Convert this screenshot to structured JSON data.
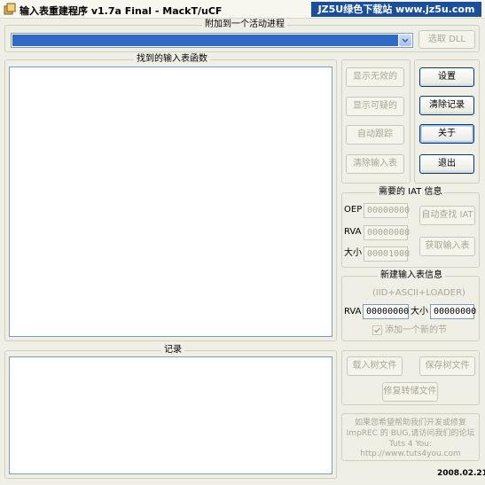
{
  "title_bar": {
    "title": "输入表重建程序 v1.7a Final - MackT/uCF",
    "watermark": "JZ5U绿色下载站 www.jz5u.com"
  },
  "process": {
    "group_label": "附加到一个活动进程",
    "pick_dll_label": "选取 DLL"
  },
  "imports": {
    "group_label": "找到的输入表函数"
  },
  "mid_buttons": {
    "show_invalid": "显示无效的",
    "show_suspect": "显示可疑的",
    "auto_trace": "自动跟踪",
    "clear_imports": "清除输入表"
  },
  "right_buttons": {
    "options": "设置",
    "clear_log": "清除记录",
    "about": "关于",
    "exit": "退出"
  },
  "iat": {
    "group_label": "需要的 IAT 信息",
    "oep_label": "OEP",
    "oep_value": "00000000",
    "rva_label": "RVA",
    "rva_value": "00000000",
    "size_label": "大小",
    "size_value": "00001000",
    "autosearch": "自动查找 IAT",
    "get_imports": "获取输入表"
  },
  "new_import": {
    "group_label": "新建输入表信息",
    "subtitle": "(IID+ASCII+LOADER)",
    "rva_label": "RVA",
    "rva_value": "00000000",
    "size_label": "大小",
    "size_value": "00000000",
    "add_section_label": "添加一个新的节",
    "add_section_checked": true
  },
  "log": {
    "group_label": "记录"
  },
  "tree_buttons": {
    "load_tree": "载入树文件",
    "save_tree": "保存树文件",
    "fix_dump": "修复转储文件"
  },
  "footer": {
    "line1": "如果您希望帮助我们开发或修复",
    "line2": "ImpREC 的 BUG,请访问我们的论坛",
    "line3": "Tuts 4 You: http://www.tuts4you.com",
    "date": "2008.02.21"
  },
  "colors": {
    "selection": "#316ac5",
    "watermark_bg": "#1b4f9c"
  }
}
